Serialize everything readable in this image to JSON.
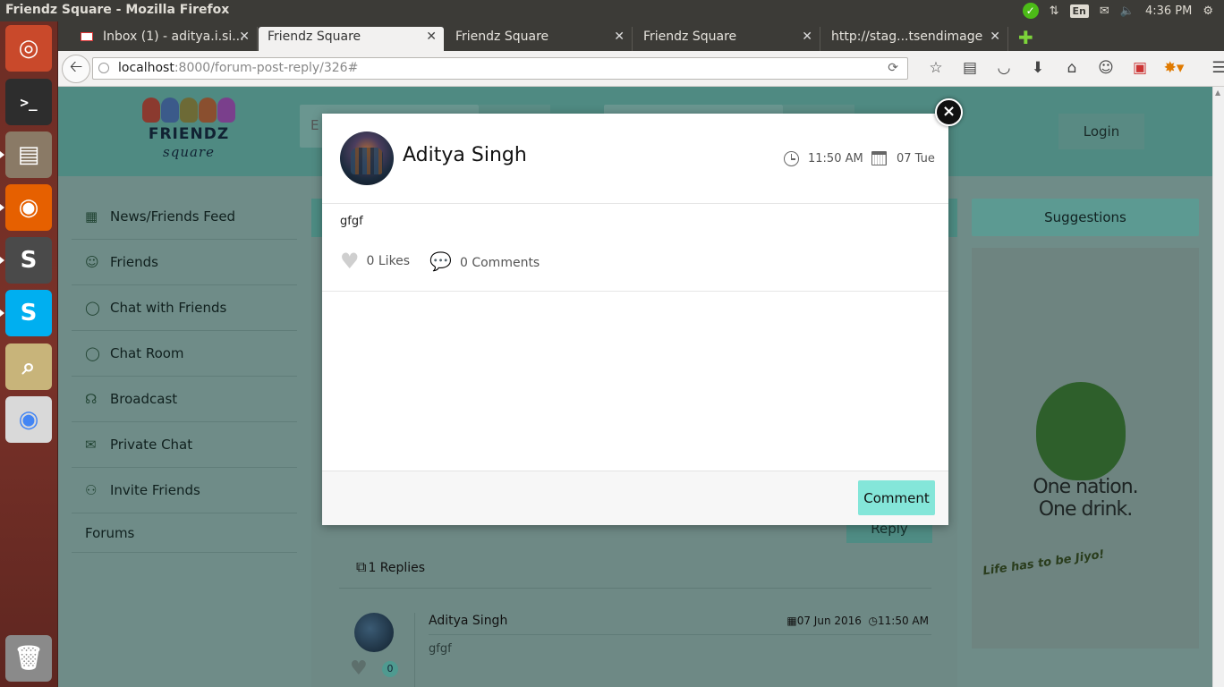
{
  "window": {
    "title": "Friendz Square - Mozilla Firefox"
  },
  "indicators": {
    "keyboard": "En",
    "clock": "4:36 PM"
  },
  "launcher": [
    {
      "name": "ubuntu-dash-icon",
      "glyph": "◎",
      "bg": "#c9492b"
    },
    {
      "name": "terminal-icon",
      "glyph": ">_",
      "bg": "#2d2d2d"
    },
    {
      "name": "files-icon",
      "glyph": "▤",
      "bg": "#8a7a66"
    },
    {
      "name": "firefox-icon",
      "glyph": "◉",
      "bg": "#e66000"
    },
    {
      "name": "sublime-text-icon",
      "glyph": "S",
      "bg": "#4a4a4a"
    },
    {
      "name": "skype-icon",
      "glyph": "S",
      "bg": "#00aff0"
    },
    {
      "name": "image-viewer-icon",
      "glyph": "⌕",
      "bg": "#c8b47a"
    },
    {
      "name": "chrome-icon",
      "glyph": "◉",
      "bg": "#d9d9d9"
    },
    {
      "name": "trash-icon",
      "glyph": "🗑",
      "bg": "#8a8a8a"
    }
  ],
  "tabs": [
    {
      "label": "Inbox (1) - aditya.i.si..."
    },
    {
      "label": "Friendz Square"
    },
    {
      "label": "Friendz Square"
    },
    {
      "label": "Friendz Square"
    },
    {
      "label": "http://stag...tsendimage"
    }
  ],
  "url": {
    "host": "localhost",
    "rest": ":8000/forum-post-reply/326#"
  },
  "site": {
    "logo_text": "FRIENDZ",
    "logo_script": "square",
    "login_label": "Login",
    "search_placeholder": "E"
  },
  "sidebar": {
    "items": [
      {
        "label": "News/Friends Feed",
        "icon": "newspaper-icon",
        "glyph": "▦"
      },
      {
        "label": "Friends",
        "icon": "friends-icon",
        "glyph": "☺"
      },
      {
        "label": "Chat with Friends",
        "icon": "chat-bubble-icon",
        "glyph": "◯"
      },
      {
        "label": "Chat Room",
        "icon": "chat-room-icon",
        "glyph": "◯"
      },
      {
        "label": "Broadcast",
        "icon": "broadcast-icon",
        "glyph": "☊"
      },
      {
        "label": "Private Chat",
        "icon": "envelope-icon",
        "glyph": "✉"
      },
      {
        "label": "Invite Friends",
        "icon": "invite-icon",
        "glyph": "⚇"
      },
      {
        "label": "Forums",
        "icon": "",
        "glyph": ""
      }
    ]
  },
  "right": {
    "suggestions_label": "Suggestions",
    "ad_line1": "One nation.",
    "ad_line2": "One drink.",
    "ad_tag": "Life has to be Jiyo!"
  },
  "thread": {
    "reply_label": "Reply",
    "replies_label": "1 Replies",
    "reply_author": "Aditya Singh",
    "reply_date": "07 Jun 2016",
    "reply_time": "11:50 AM",
    "reply_text": "gfgf",
    "reply_likes": "0"
  },
  "modal": {
    "author": "Aditya Singh",
    "time": "11:50 AM",
    "date": "07 Tue",
    "body": "gfgf",
    "likes": "0 Likes",
    "comments": "0 Comments",
    "comment_button": "Comment",
    "close_glyph": "×"
  }
}
